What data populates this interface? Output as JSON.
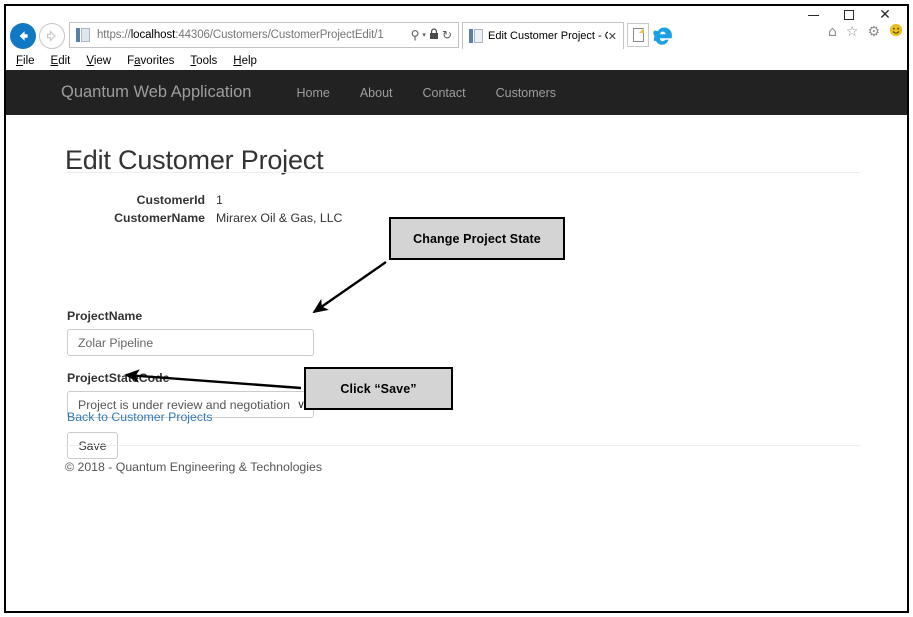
{
  "window": {
    "controls": {
      "minimize": "minimize-button",
      "maximize": "maximize-button",
      "close": "close-button",
      "close_glyph": "✕"
    }
  },
  "browser": {
    "address_bar": {
      "scheme": "https://",
      "host": "localhost",
      "rest": ":44306/Customers/CustomerProjectEdit/1",
      "full_url": "https://localhost:44306/Customers/CustomerProjectEdit/1",
      "search_icon": "⚲",
      "caret": "▾",
      "lock_icon": "🔒",
      "refresh_icon": "↻"
    },
    "tab": {
      "title": "Edit Customer Project - Qu...",
      "close_glyph": "✕"
    },
    "new_tab_label": "",
    "ie_logo_glyph": "e",
    "toolbar_icons": {
      "home": "⌂",
      "favorites": "☆",
      "tools": "⚙",
      "feedback": "☺"
    },
    "menu": [
      {
        "pre": "",
        "accel": "F",
        "post": "ile"
      },
      {
        "pre": "",
        "accel": "E",
        "post": "dit"
      },
      {
        "pre": "",
        "accel": "V",
        "post": "iew"
      },
      {
        "pre": "F",
        "accel": "a",
        "post": "vorites"
      },
      {
        "pre": "",
        "accel": "T",
        "post": "ools"
      },
      {
        "pre": "",
        "accel": "H",
        "post": "elp"
      }
    ]
  },
  "site": {
    "brand": "Quantum Web Application",
    "nav": [
      {
        "label": "Home"
      },
      {
        "label": "About"
      },
      {
        "label": "Contact"
      },
      {
        "label": "Customers"
      }
    ]
  },
  "page": {
    "title": "Edit Customer Project",
    "details": [
      {
        "term": "CustomerId",
        "value": "1"
      },
      {
        "term": "CustomerName",
        "value": "Mirarex Oil & Gas, LLC"
      }
    ],
    "form": {
      "project_name": {
        "label": "ProjectName",
        "value": "Zolar Pipeline",
        "placeholder": "Zolar Pipeline"
      },
      "project_state_code": {
        "label": "ProjectStateCode",
        "selected": "Project is under review and negotiation",
        "caret": "∨"
      },
      "save_label": "Save"
    },
    "back_link": "Back to Customer Projects",
    "footer": "© 2018 - Quantum Engineering & Technologies"
  },
  "annotations": [
    {
      "id": "change-state",
      "text": "Change Project State"
    },
    {
      "id": "click-save",
      "text": "Click “Save”"
    }
  ],
  "colors": {
    "navbar_bg": "#222222",
    "navbar_text": "#9d9d9d",
    "link": "#337ab7",
    "callout_bg": "#d4d4d4",
    "back_button": "#1179c4"
  }
}
